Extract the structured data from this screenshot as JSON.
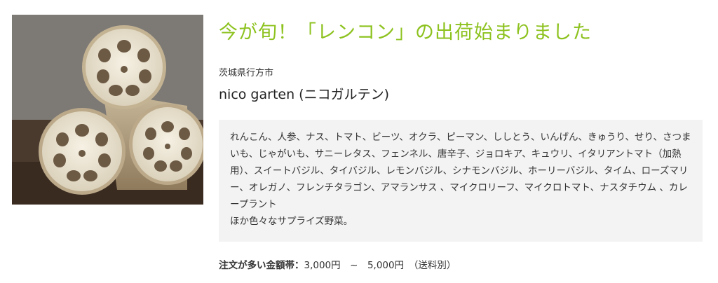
{
  "headline": "今が旬！「レンコン」の出荷始まりました",
  "location": "茨城県行方市",
  "farm_name": "nico garten (ニコガルテン)",
  "vegetables": "れんこん、人参、ナス、トマト、ビーツ、オクラ、ピーマン、ししとう、いんげん、きゅうり、せり、さつまいも、じゃがいも、サニーレタス、フェンネル、唐辛子、ジョロキア、キュウリ、イタリアントマト（加熱用）、スイートバジル、タイバジル、レモンバジル、シナモンバジル、ホーリーバジル、タイム、ローズマリー、オレガノ、フレンチタラゴン、アマランサス 、マイクロリーフ、マイクロトマト、ナスタチウム 、カレープラント",
  "vegetables_extra": "ほか色々なサプライズ野菜。",
  "price": {
    "label": "注文が多い金額帯：",
    "range": "3,000円　~　5,000円　（送料別）"
  },
  "colors": {
    "accent": "#8dc21f",
    "box_bg": "#f3f3f3"
  }
}
